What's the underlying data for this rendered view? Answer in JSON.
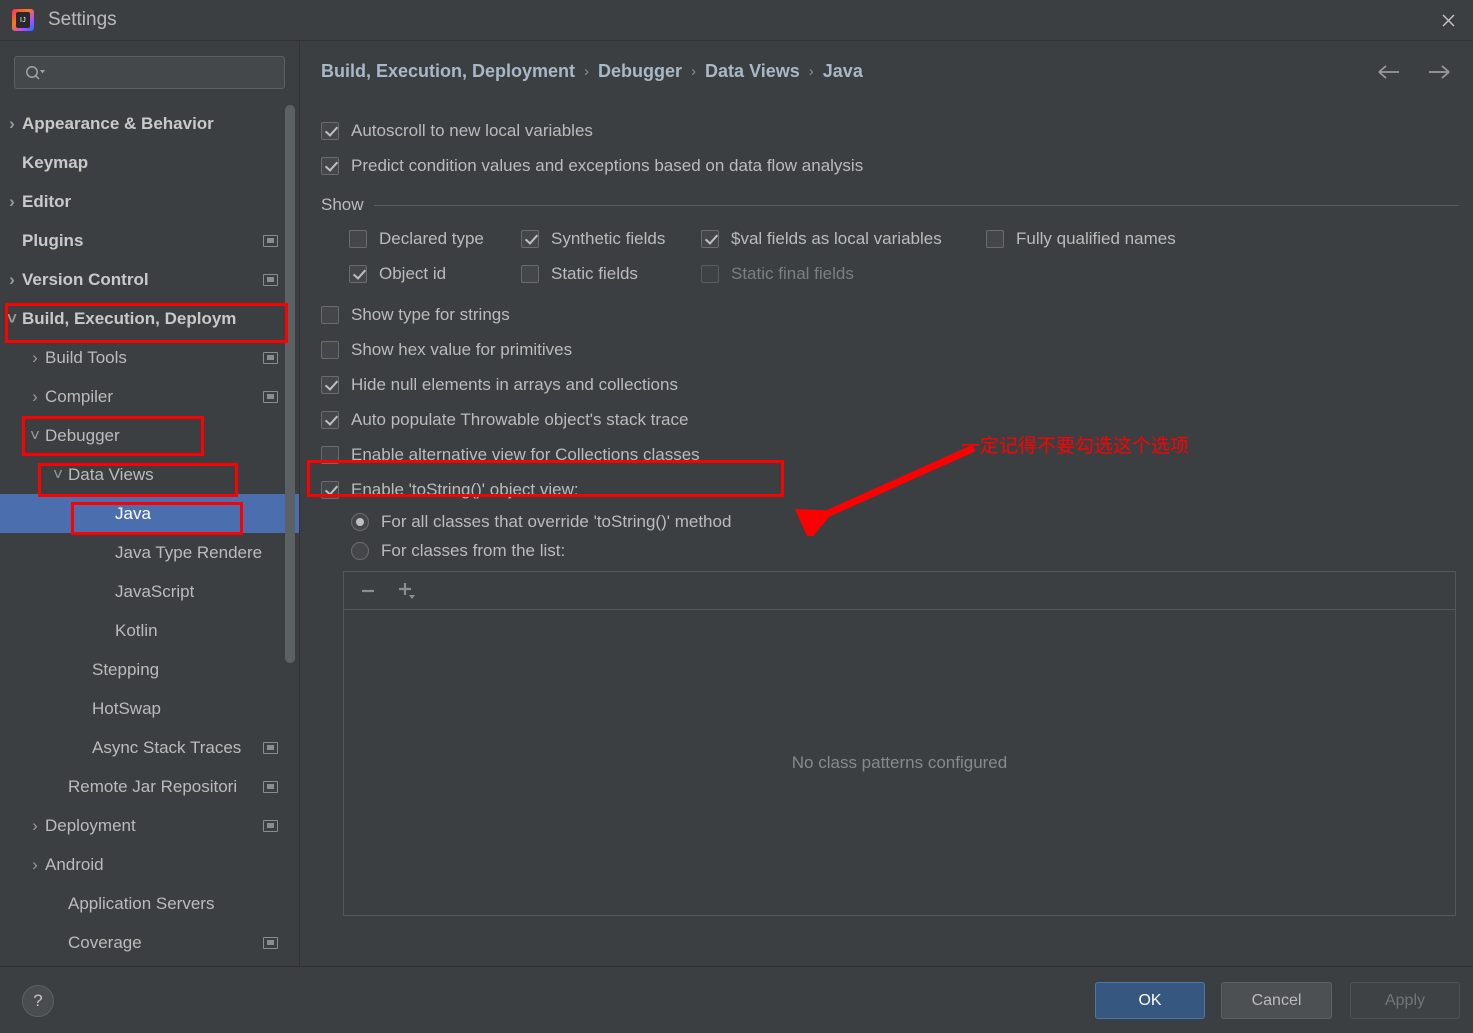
{
  "window": {
    "title": "Settings",
    "logo_text": "IJ",
    "close_icon": "×"
  },
  "sidebar": {
    "search": {
      "placeholder": "",
      "value": "",
      "icon": "search-icon"
    },
    "items": [
      {
        "label": "Appearance & Behavior",
        "chevron": "›",
        "bold": true,
        "indent": 22,
        "badge": false,
        "selected": false
      },
      {
        "label": "Keymap",
        "chevron": "",
        "bold": true,
        "indent": 22,
        "badge": false,
        "selected": false
      },
      {
        "label": "Editor",
        "chevron": "›",
        "bold": true,
        "indent": 22,
        "badge": false,
        "selected": false
      },
      {
        "label": "Plugins",
        "chevron": "",
        "bold": true,
        "indent": 22,
        "badge": true,
        "selected": false
      },
      {
        "label": "Version Control",
        "chevron": "›",
        "bold": true,
        "indent": 22,
        "badge": true,
        "selected": false
      },
      {
        "label": "Build, Execution, Deploym",
        "chevron": "˅",
        "bold": true,
        "indent": 22,
        "badge": false,
        "selected": false
      },
      {
        "label": "Build Tools",
        "chevron": "›",
        "bold": false,
        "indent": 45,
        "badge": true,
        "selected": false
      },
      {
        "label": "Compiler",
        "chevron": "›",
        "bold": false,
        "indent": 45,
        "badge": true,
        "selected": false
      },
      {
        "label": "Debugger",
        "chevron": "˅",
        "bold": false,
        "indent": 45,
        "badge": false,
        "selected": false
      },
      {
        "label": "Data Views",
        "chevron": "˅",
        "bold": false,
        "indent": 68,
        "badge": false,
        "selected": false
      },
      {
        "label": "Java",
        "chevron": "",
        "bold": false,
        "indent": 115,
        "badge": false,
        "selected": true
      },
      {
        "label": "Java Type Rendere",
        "chevron": "",
        "bold": false,
        "indent": 115,
        "badge": false,
        "selected": false
      },
      {
        "label": "JavaScript",
        "chevron": "",
        "bold": false,
        "indent": 115,
        "badge": false,
        "selected": false
      },
      {
        "label": "Kotlin",
        "chevron": "",
        "bold": false,
        "indent": 115,
        "badge": false,
        "selected": false
      },
      {
        "label": "Stepping",
        "chevron": "",
        "bold": false,
        "indent": 92,
        "badge": false,
        "selected": false
      },
      {
        "label": "HotSwap",
        "chevron": "",
        "bold": false,
        "indent": 92,
        "badge": false,
        "selected": false
      },
      {
        "label": "Async Stack Traces",
        "chevron": "",
        "bold": false,
        "indent": 92,
        "badge": true,
        "selected": false
      },
      {
        "label": "Remote Jar Repositori",
        "chevron": "",
        "bold": false,
        "indent": 68,
        "badge": true,
        "selected": false
      },
      {
        "label": "Deployment",
        "chevron": "›",
        "bold": false,
        "indent": 45,
        "badge": true,
        "selected": false
      },
      {
        "label": "Android",
        "chevron": "›",
        "bold": false,
        "indent": 45,
        "badge": false,
        "selected": false
      },
      {
        "label": "Application Servers",
        "chevron": "",
        "bold": false,
        "indent": 68,
        "badge": false,
        "selected": false
      },
      {
        "label": "Coverage",
        "chevron": "",
        "bold": false,
        "indent": 68,
        "badge": true,
        "selected": false
      }
    ]
  },
  "main": {
    "breadcrumb": [
      "Build, Execution, Deployment",
      "Debugger",
      "Data Views",
      "Java"
    ],
    "breadcrumb_separator": "›",
    "nav": {
      "back_icon": "←",
      "forward_icon": "→"
    },
    "top_checkboxes": [
      {
        "label": "Autoscroll to new local variables",
        "checked": true
      },
      {
        "label": "Predict condition values and exceptions based on data flow analysis",
        "checked": true
      }
    ],
    "show_group": {
      "title": "Show",
      "row1": [
        {
          "label": "Declared type",
          "checked": false,
          "disabled": false
        },
        {
          "label": "Synthetic fields",
          "checked": true,
          "disabled": false
        },
        {
          "label": "$val fields as local variables",
          "checked": true,
          "disabled": false
        },
        {
          "label": "Fully qualified names",
          "checked": false,
          "disabled": false
        }
      ],
      "row2": [
        {
          "label": "Object id",
          "checked": true,
          "disabled": false
        },
        {
          "label": "Static fields",
          "checked": false,
          "disabled": false
        },
        {
          "label": "Static final fields",
          "checked": false,
          "disabled": true
        }
      ]
    },
    "mid_checkboxes": [
      {
        "label": "Show type for strings",
        "checked": false
      },
      {
        "label": "Show hex value for primitives",
        "checked": false
      },
      {
        "label": "Hide null elements in arrays and collections",
        "checked": true
      },
      {
        "label": "Auto populate Throwable object's stack trace",
        "checked": true
      },
      {
        "label": "Enable alternative view for Collections classes",
        "checked": false
      }
    ],
    "tostring": {
      "checkbox_label": "Enable 'toString()' object view:",
      "checkbox_checked": true,
      "radios": [
        {
          "label": "For all classes that override 'toString()' method",
          "selected": true
        },
        {
          "label": "For classes from the list:",
          "selected": false
        }
      ]
    },
    "class_list": {
      "remove_icon": "−",
      "add_icon": "+",
      "add_dropdown_icon": "˅",
      "empty_text": "No class patterns configured"
    }
  },
  "annotations": {
    "color": "#ff0000",
    "note_text": "一定记得不要勾选这个选项"
  },
  "footer": {
    "help_icon": "?",
    "ok_label": "OK",
    "cancel_label": "Cancel",
    "apply_label": "Apply"
  }
}
